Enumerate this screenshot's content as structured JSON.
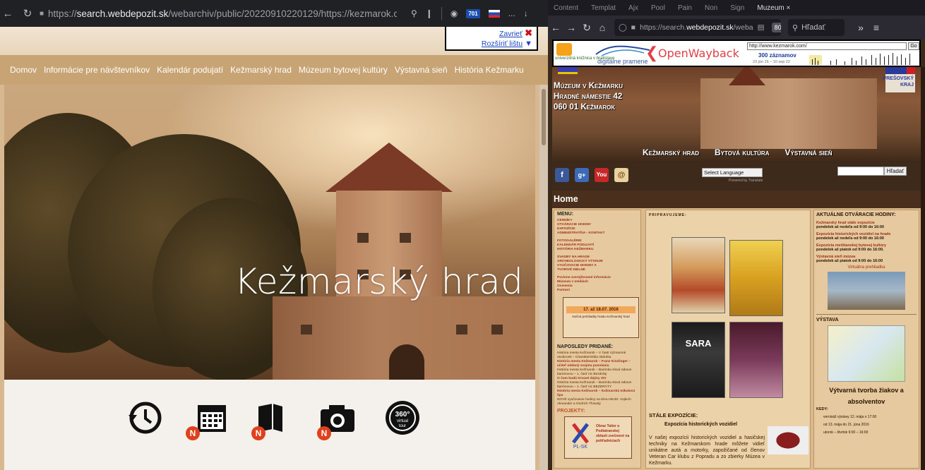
{
  "left_window": {
    "toolbar": {
      "back_icon": "←",
      "reload_icon": "↻",
      "lock_icon": "🔒",
      "url_prefix": "https://",
      "url_host": "search.webdepozit.sk",
      "url_path": "/webarchiv/public/20220910220129/https://kezmarok.co...",
      "badge_count": "701",
      "more_icon": "...",
      "download_icon": "↓"
    },
    "wayback_mini": {
      "close_label": "Zavrieť",
      "expand_label": "Rozšíriť lištu",
      "close_icon": "✖",
      "expand_icon": "▼"
    },
    "nav": [
      "Domov",
      "Informácie pre návštevníkov",
      "Kalendár podujatí",
      "Kežmarský hrad",
      "Múzeum bytovej kultúry",
      "Výstavná sieň",
      "História Kežmarku"
    ],
    "hero_title": "Kežmarský hrad",
    "quick_icons": [
      {
        "name": "opening-hours-icon",
        "badge": ""
      },
      {
        "name": "calendar-icon",
        "badge": "N"
      },
      {
        "name": "book-icon",
        "badge": "N"
      },
      {
        "name": "camera-icon",
        "badge": "N"
      },
      {
        "name": "virtual-tour-icon",
        "badge": ""
      }
    ],
    "virtual_tour": {
      "line1": "360°",
      "line2": "virtual",
      "line3": "tour"
    }
  },
  "right_window": {
    "tabs": [
      "Content",
      "Templat",
      "Ajx",
      "Pool",
      "Pain",
      "Non",
      "Sign",
      "Muzeum ×"
    ],
    "toolbar": {
      "url_prefix": "https://search.",
      "url_host": "webdepozit.sk",
      "url_rest": "/weba",
      "zoom": "80 %",
      "search_label": "Hľadať"
    },
    "wayback": {
      "univ_text": "univerzitná knižnica v bratislave",
      "digital_text": "digitálne pramene",
      "openwayback": "OpenWayback",
      "url_value": "http://www.kezmarok.com/",
      "go_label": "Go",
      "count": "300 záznamov",
      "range": "23 jún 16 – 10 sep 22"
    },
    "banner": {
      "address": [
        "Múzeum v Kežmarku",
        "Hradné námestie 42",
        "060 01 Kežmarok"
      ],
      "region": [
        "PREŠOVSKÝ",
        "KRAJ"
      ],
      "menu": [
        "Kežmarský hrad",
        "Bytová kultúra",
        "Výstavná sieň"
      ]
    },
    "social": {
      "fb": "f",
      "gplus": "g+",
      "yt": "You",
      "select_language": "Select Language",
      "powered": "Powered by Translate",
      "search_btn": "Hľadať"
    },
    "home_title": "Home",
    "left_col": {
      "menu_title": "MENU:",
      "menu_links": [
        "CENNÍKY",
        "OTVÁRACIE HODINY",
        "EXPOZÍCIE",
        "ADMINISTRATÍVA - KONTAKT",
        "",
        "FOTOGALÉRIE",
        "KALENDÁR PODUJATÍ",
        "HISTÓRIA KEŽMARKU",
        "",
        "SVADBY NA HRADE",
        "ARCHEOLOGICKÝ VÝSKUM",
        "VYUČOVACIE HODINY A",
        "TVORIVÉ DIELNE",
        "",
        "Povinne zverejňované informácie",
        "Múzeum v médiách",
        "Ocenenia",
        "Partneri"
      ],
      "event_date": "17. až 18.07. 2016",
      "event_text": "Nočná prehliadky hradu Kežmarský hrad",
      "recent_title": "NAPOSLEDY PRIDANÉ:",
      "recent_items": [
        "História mesta Kežmarok – V časti Významné osobnosti – Charakteristika obdobia",
        "História mesta Kežmarok – Franz Kinzlinger – učiteľ oddaný svojmu povolaniu",
        "História mesta Kežmarok – Barónka slová rabove barónovou – 1. časť nic Bezdráty",
        "O čom budú Krvavé dejiny XIV",
        "História mesta Kežmarok – Barónka slová rabove barónovou – 1. časť nic BEZDRÁTY",
        "História mesta Kežmarok – Kežmarská mikulová špa",
        "NOVÉ vyučovacie hodiny na tému MUDr. Vojtech Alexander a Ondrich Thowdy"
      ],
      "projects_title": "PROJEKTY:",
      "project_text": "Obraz Tatier a Podtatranskej oblasti zvečnené na pohľadniciach",
      "project_logo": "PL-SK"
    },
    "mid_col": {
      "heading": "PRIPRAVUJEME:",
      "exp_section": "STÁLE EXPOZÍCIE:",
      "exp_title": "Expozícia historických vozidiel",
      "exp_text": "V našej expozícii historických vozidiel a hasičskej techniky na Kežmarskom hrade môžete vidieť unikátne autá a motorky, zapožičané od členov Veteran Car klubu z Popradu a zo zbierky Múzea v Kežmarku.",
      "poster_sara": "SARA"
    },
    "right_col": {
      "hours_title": "AKTUÁLNE OTVÁRACIE HODINY:",
      "items": [
        {
          "red": "Kežmarský hrad stále expozície",
          "text": "pondelok až nedeľa od 9:00 do 16:00"
        },
        {
          "red": "Expozícia historických vozidiel na hrade",
          "text": "pondelok až nedeľa od 9:00 do 16:00"
        },
        {
          "red": "Expozícia meštianskej bytovej kultúry",
          "text": "pondelok až piatok od 9:00 do 16:00."
        },
        {
          "red": "Výstavná sieň múzea",
          "text": "pondelok až piatok od 9:00 do 16:00"
        }
      ],
      "virtual": "Virtuálna prehliadka",
      "vystava_title": "VÝSTAVA",
      "vystava_subtitle": "Výtvarná tvorba žiakov a absolventov",
      "kedy": "KEDY:",
      "bullets": [
        "vernisáž výstavy 12. mája o 17:00",
        "od 13. mája do 21. júna 2016",
        "utorok – štvrtok 9:00 – 16:00"
      ]
    }
  }
}
